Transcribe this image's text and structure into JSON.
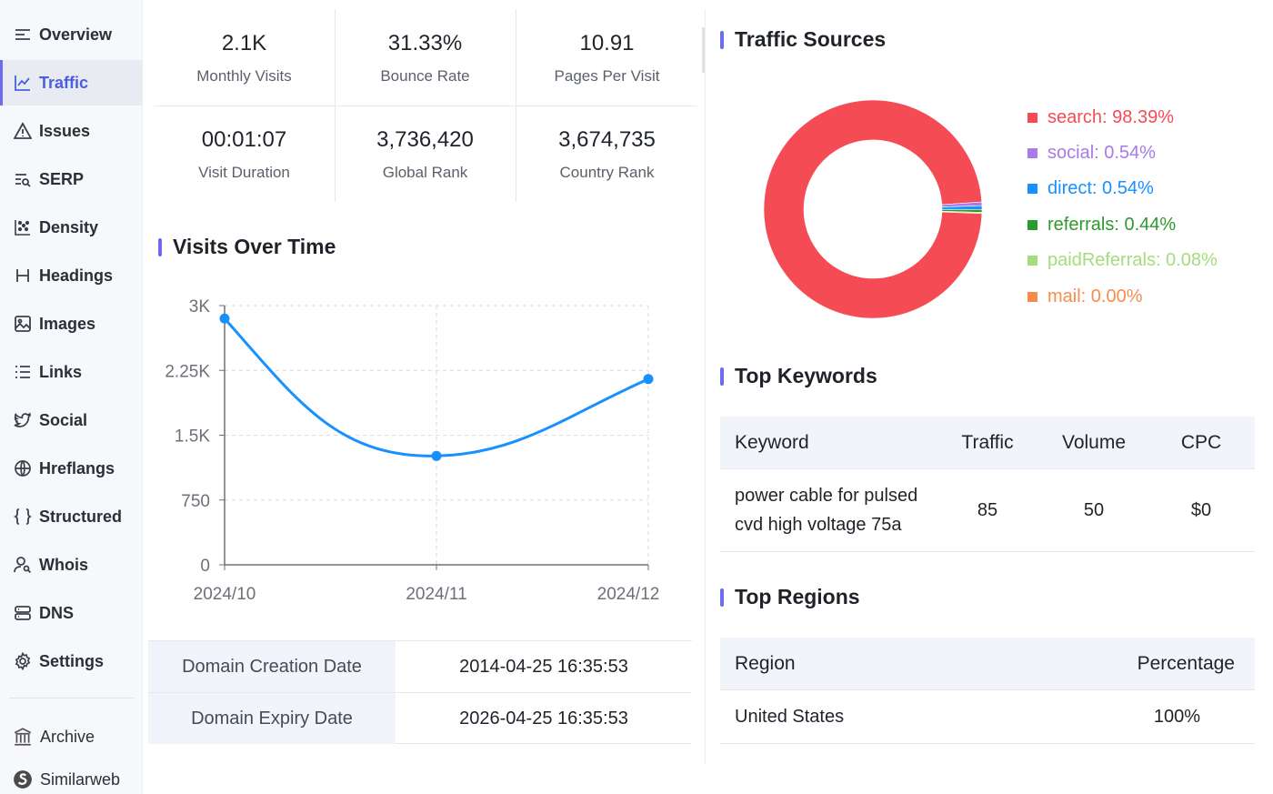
{
  "sidebar": {
    "items": [
      {
        "label": "Overview",
        "icon": "menu-lines-icon"
      },
      {
        "label": "Traffic",
        "icon": "line-chart-icon",
        "active": true
      },
      {
        "label": "Issues",
        "icon": "warning-icon"
      },
      {
        "label": "SERP",
        "icon": "serp-icon"
      },
      {
        "label": "Density",
        "icon": "scatter-icon"
      },
      {
        "label": "Headings",
        "icon": "heading-icon"
      },
      {
        "label": "Images",
        "icon": "image-icon"
      },
      {
        "label": "Links",
        "icon": "list-icon"
      },
      {
        "label": "Social",
        "icon": "twitter-icon"
      },
      {
        "label": "Hreflangs",
        "icon": "globe-icon"
      },
      {
        "label": "Structured",
        "icon": "braces-icon"
      },
      {
        "label": "Whois",
        "icon": "user-search-icon"
      },
      {
        "label": "DNS",
        "icon": "server-icon"
      },
      {
        "label": "Settings",
        "icon": "gear-icon"
      }
    ],
    "external": [
      {
        "label": "Archive",
        "icon": "archive-icon"
      },
      {
        "label": "Similarweb",
        "icon": "similarweb-icon"
      }
    ],
    "accent_color": "#6c6cf0"
  },
  "stats": [
    {
      "value": "2.1K",
      "caption": "Monthly Visits"
    },
    {
      "value": "31.33%",
      "caption": "Bounce Rate"
    },
    {
      "value": "10.91",
      "caption": "Pages Per Visit"
    },
    {
      "value": "00:01:07",
      "caption": "Visit Duration"
    },
    {
      "value": "3,736,420",
      "caption": "Global Rank"
    },
    {
      "value": "3,674,735",
      "caption": "Country Rank"
    }
  ],
  "visits": {
    "title": "Visits Over Time"
  },
  "domain": [
    {
      "key": "Domain Creation Date",
      "value": "2014-04-25 16:35:53"
    },
    {
      "key": "Domain Expiry Date",
      "value": "2026-04-25 16:35:53"
    }
  ],
  "traffic_sources": {
    "title": "Traffic Sources",
    "legend": [
      {
        "label": "search: 98.39%",
        "color": "#f54b55"
      },
      {
        "label": "social: 0.54%",
        "color": "#a97ae8"
      },
      {
        "label": "direct: 0.54%",
        "color": "#1890ff"
      },
      {
        "label": "referrals: 0.44%",
        "color": "#2d9a2d"
      },
      {
        "label": "paidReferrals: 0.08%",
        "color": "#a6dc7c"
      },
      {
        "label": "mail: 0.00%",
        "color": "#f58c4a"
      }
    ]
  },
  "keywords": {
    "title": "Top Keywords",
    "headers": {
      "keyword": "Keyword",
      "traffic": "Traffic",
      "volume": "Volume",
      "cpc": "CPC"
    },
    "rows": [
      {
        "keyword_line1": "power cable for pulsed",
        "keyword_line2": "cvd high voltage 75a",
        "traffic": "85",
        "volume": "50",
        "cpc": "$0"
      }
    ]
  },
  "regions": {
    "title": "Top Regions",
    "headers": {
      "region": "Region",
      "percentage": "Percentage"
    },
    "rows": [
      {
        "region": "United States",
        "percentage": "100%"
      }
    ]
  },
  "chart_data": [
    {
      "type": "line",
      "x": [
        "2024/10",
        "2024/11",
        "2024/12"
      ],
      "series": [
        {
          "values": [
            2850,
            1260,
            2150
          ],
          "color": "#1890ff"
        }
      ],
      "ylim": [
        0,
        3000
      ],
      "yticks": [
        "0",
        "750",
        "1.5K",
        "2.25K",
        "3K"
      ],
      "grid": true
    },
    {
      "type": "pie",
      "donut": true,
      "categories": [
        "search",
        "social",
        "direct",
        "referrals",
        "paidReferrals",
        "mail"
      ],
      "values": [
        98.39,
        0.54,
        0.54,
        0.44,
        0.08,
        0.0
      ],
      "colors": [
        "#f54b55",
        "#a97ae8",
        "#1890ff",
        "#2d9a2d",
        "#a6dc7c",
        "#f58c4a"
      ],
      "legend_position": "right"
    }
  ]
}
